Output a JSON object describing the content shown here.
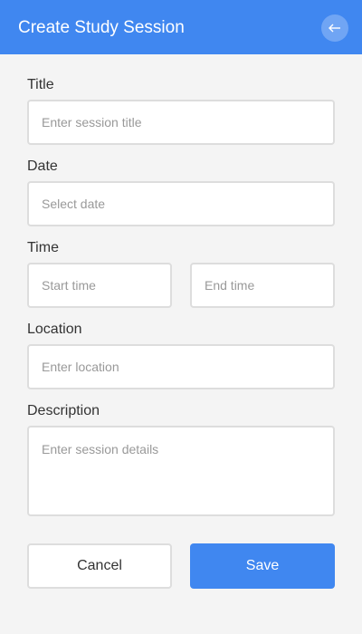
{
  "header": {
    "title": "Create Study Session",
    "back_icon": "arrow-left-icon",
    "color": "#4087f0"
  },
  "form": {
    "title": {
      "label": "Title",
      "placeholder": "Enter session title",
      "value": ""
    },
    "date": {
      "label": "Date",
      "placeholder": "Select date",
      "value": ""
    },
    "time": {
      "label": "Time",
      "start_placeholder": "Start time",
      "end_placeholder": "End time"
    },
    "location": {
      "label": "Location",
      "placeholder": "Enter location",
      "value": ""
    },
    "description": {
      "label": "Description",
      "placeholder": "Enter session details",
      "value": ""
    }
  },
  "actions": {
    "cancel_label": "Cancel",
    "save_label": "Save"
  }
}
